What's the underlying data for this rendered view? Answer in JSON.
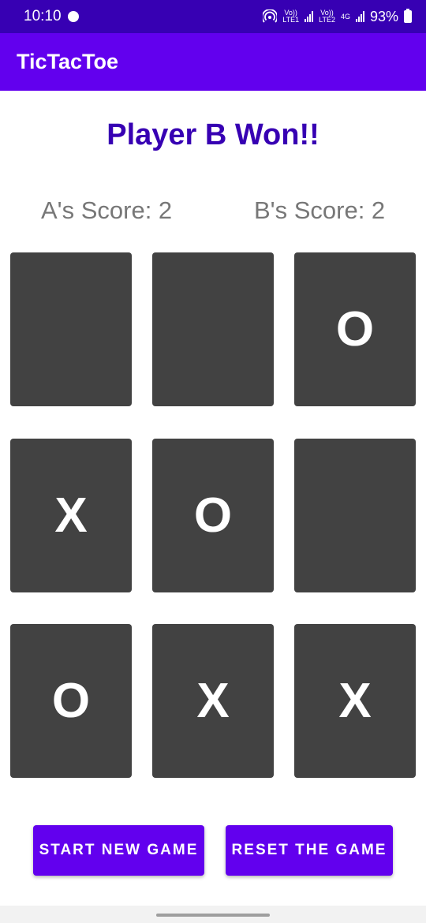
{
  "status_bar": {
    "time": "10:10",
    "sim1_label_top": "Vo))",
    "sim1_label_bottom": "LTE1",
    "sim2_label_top": "Vo))",
    "sim2_label_bottom": "LTE2",
    "network_label": "4G",
    "battery": "93%"
  },
  "app_bar": {
    "title": "TicTacToe"
  },
  "game": {
    "result": "Player B Won!!",
    "score_a": "A's Score: 2",
    "score_b": "B's Score: 2",
    "board": [
      [
        "",
        "",
        "O"
      ],
      [
        "X",
        "O",
        ""
      ],
      [
        "O",
        "X",
        "X"
      ]
    ]
  },
  "buttons": {
    "start": "START NEW GAME",
    "reset": "RESET THE GAME"
  },
  "colors": {
    "status_bar": "#3700b3",
    "primary": "#6200ee",
    "cell": "#424242",
    "result_text": "#3700b3",
    "score_text": "#777777"
  }
}
